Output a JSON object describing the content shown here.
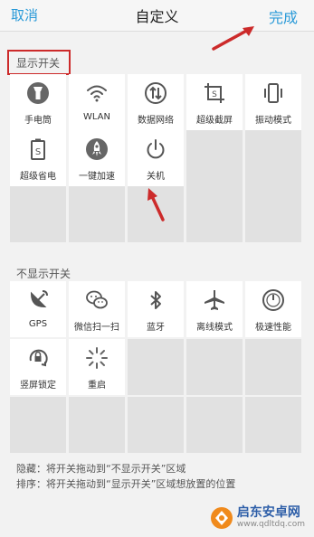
{
  "header": {
    "cancel": "取消",
    "title": "自定义",
    "done": "完成"
  },
  "shown": {
    "label": "显示开关",
    "items": [
      {
        "label": "手电筒",
        "icon": "flashlight-icon"
      },
      {
        "label": "WLAN",
        "icon": "wifi-icon"
      },
      {
        "label": "数据网络",
        "icon": "mobile-data-icon"
      },
      {
        "label": "超级截屏",
        "icon": "screenshot-icon"
      },
      {
        "label": "振动模式",
        "icon": "vibrate-icon"
      },
      {
        "label": "超级省电",
        "icon": "power-saver-icon"
      },
      {
        "label": "一键加速",
        "icon": "rocket-icon"
      },
      {
        "label": "关机",
        "icon": "power-icon"
      }
    ]
  },
  "hidden": {
    "label": "不显示开关",
    "items": [
      {
        "label": "GPS",
        "icon": "gps-icon"
      },
      {
        "label": "微信扫一扫",
        "icon": "wechat-icon"
      },
      {
        "label": "蓝牙",
        "icon": "bluetooth-icon"
      },
      {
        "label": "离线模式",
        "icon": "airplane-icon"
      },
      {
        "label": "极速性能",
        "icon": "performance-gauge-icon"
      },
      {
        "label": "竖屏锁定",
        "icon": "rotation-lock-icon"
      },
      {
        "label": "重启",
        "icon": "restart-icon"
      }
    ]
  },
  "notes": {
    "hide": "隐藏：将开关拖动到“不显示开关”区域",
    "sort": "排序：将开关拖动到“显示开关”区域想放置的位置"
  },
  "watermark": {
    "title": "启东安卓网",
    "url": "www.qdltdq.com"
  },
  "colors": {
    "accent": "#2a9ad8",
    "annotation": "#cc2a2a"
  }
}
